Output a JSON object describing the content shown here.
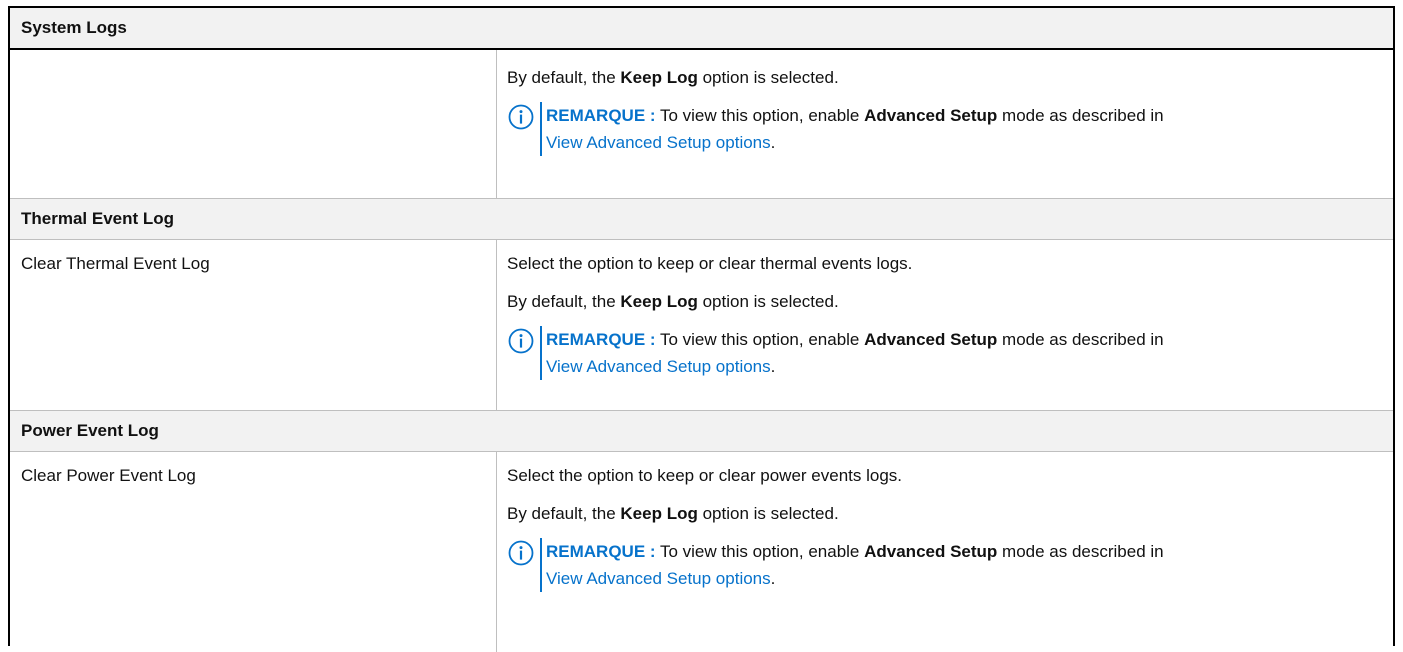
{
  "table": {
    "title": "System Logs",
    "cont": {
      "default_prefix": "By default, the ",
      "default_bold": "Keep Log",
      "default_suffix": " option is selected.",
      "note_label": "REMARQUE :",
      "note_text1": " To view this option, enable ",
      "note_bold": "Advanced Setup",
      "note_text2": " mode as described in",
      "note_link": "View Advanced Setup options",
      "note_end": "."
    },
    "sections": [
      {
        "heading": "Thermal Event Log",
        "option": "Clear Thermal Event Log",
        "description": "Select the option to keep or clear thermal events logs.",
        "default_prefix": "By default, the ",
        "default_bold": "Keep Log",
        "default_suffix": " option is selected.",
        "note_label": "REMARQUE :",
        "note_text1": " To view this option, enable ",
        "note_bold": "Advanced Setup",
        "note_text2": " mode as described in",
        "note_link": "View Advanced Setup options",
        "note_end": "."
      },
      {
        "heading": "Power Event Log",
        "option": "Clear Power Event Log",
        "description": "Select the option to keep or clear power events logs.",
        "default_prefix": "By default, the ",
        "default_bold": "Keep Log",
        "default_suffix": " option is selected.",
        "note_label": "REMARQUE :",
        "note_text1": " To view this option, enable ",
        "note_bold": "Advanced Setup",
        "note_text2": " mode as described in",
        "note_link": "View Advanced Setup options",
        "note_end": "."
      }
    ]
  },
  "icons": {
    "note": "info-circle-icon"
  },
  "colors": {
    "accent": "#0672cb",
    "header_bg": "#f2f2f2",
    "rule": "#bfbfbf"
  }
}
